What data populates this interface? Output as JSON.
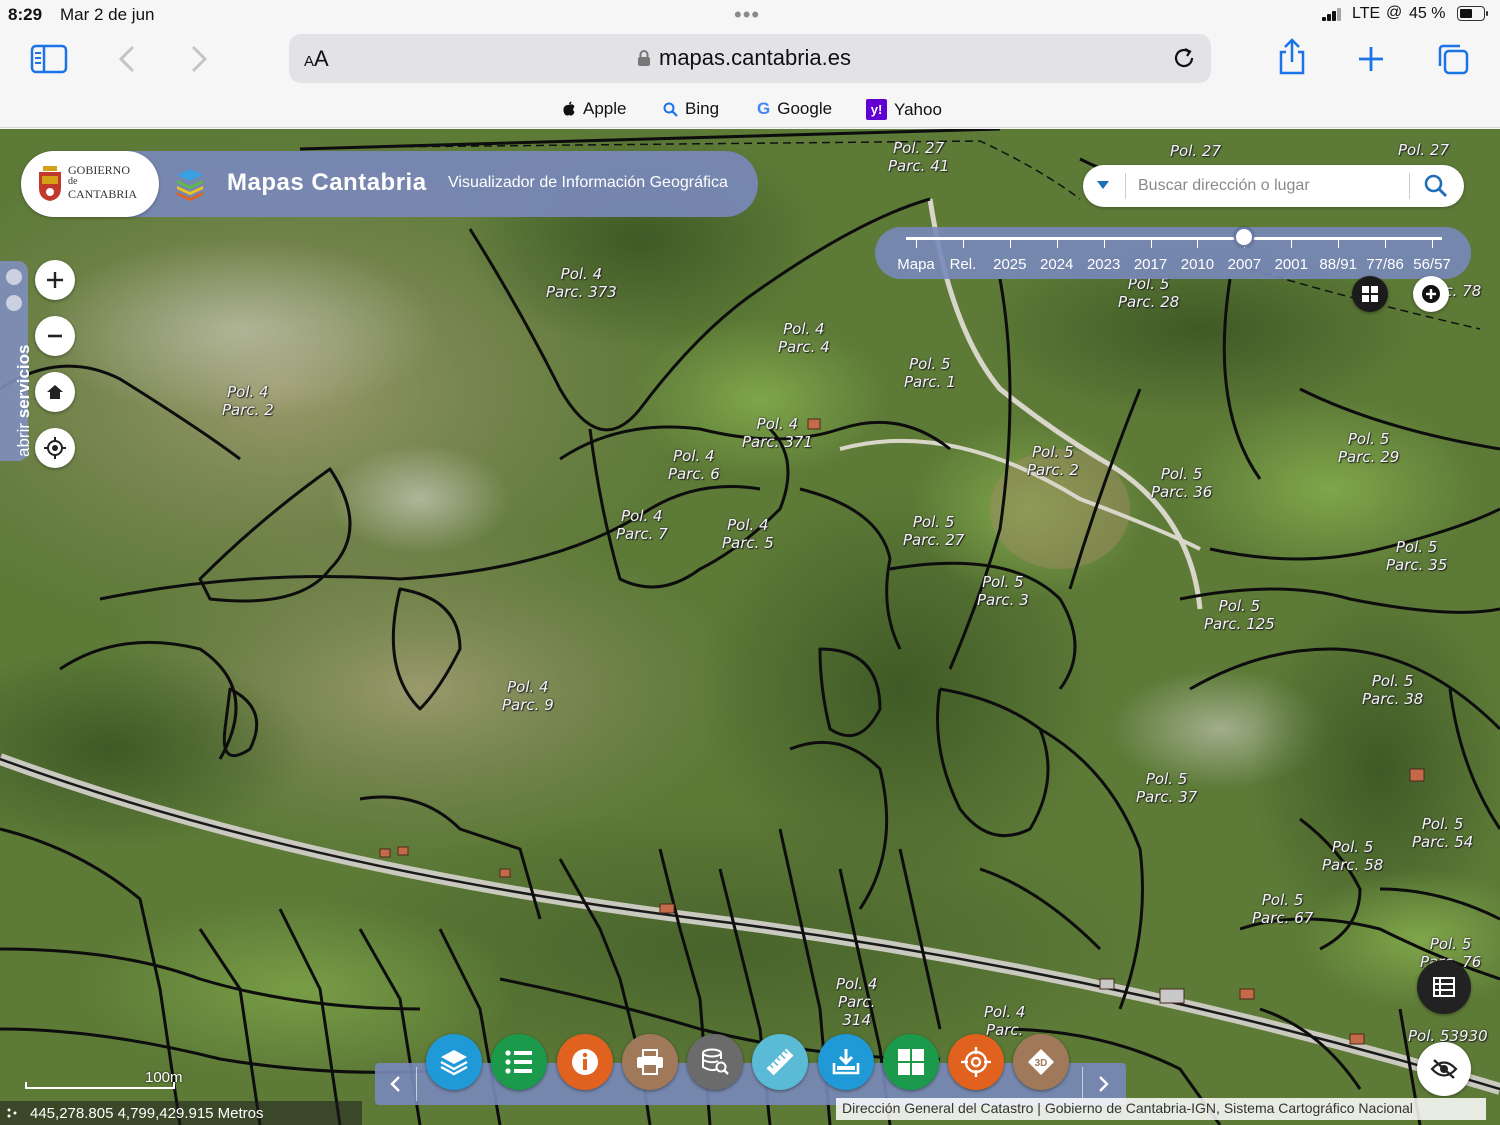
{
  "status": {
    "time": "8:29",
    "date": "Mar 2 de jun",
    "network": "LTE",
    "battery": "45 %",
    "battery_level": 0.45
  },
  "browser": {
    "text_size_button": "AA",
    "url": "mapas.cantabria.es",
    "favorites": [
      {
        "label": "Apple",
        "icon": "apple-icon"
      },
      {
        "label": "Bing",
        "icon": "search-icon"
      },
      {
        "label": "Google",
        "icon": "google-icon"
      },
      {
        "label": "Yahoo",
        "icon": "yahoo-icon"
      }
    ],
    "accent": "#1a73e8"
  },
  "header": {
    "gov_logo_lines": [
      "GOBIERNO",
      "de",
      "CANTABRIA"
    ],
    "title": "Mapas Cantabria",
    "subtitle": "Visualizador de Información Geográfica",
    "accent": "#7888ba"
  },
  "search": {
    "placeholder": "Buscar dirección o lugar"
  },
  "timeline": {
    "labels": [
      "Mapa",
      "Rel.",
      "2025",
      "2024",
      "2023",
      "2017",
      "2010",
      "2007",
      "2001",
      "88/91",
      "77/86",
      "56/57"
    ],
    "selected": "2007",
    "selected_index": 7
  },
  "services": {
    "label_prefix": "abrir",
    "label_bold": "servicios"
  },
  "map": {
    "parcels": [
      {
        "pol": "Pol. 27",
        "parc": "Parc. 41"
      },
      {
        "pol": "Pol. 27",
        "parc": ""
      },
      {
        "pol": "Pol. 27",
        "parc": ""
      },
      {
        "pol": "Pol. 4",
        "parc": "Parc. 373"
      },
      {
        "pol": "Pol. 5",
        "parc": "Parc. 28"
      },
      {
        "pol": "Pol. 4",
        "parc": "Parc. 4"
      },
      {
        "pol": "Pol. 5",
        "parc": "Parc. 1"
      },
      {
        "pol": "Pol. 4",
        "parc": "Parc. 2"
      },
      {
        "pol": "Pol. 4",
        "parc": "Parc. 371"
      },
      {
        "pol": "Pol. 4",
        "parc": "Parc. 6"
      },
      {
        "pol": "Pol. 5",
        "parc": "Parc. 2"
      },
      {
        "pol": "Pol. 5",
        "parc": "Parc. 36"
      },
      {
        "pol": "Pol. 5",
        "parc": "Parc. 29"
      },
      {
        "pol": "Pol. 4",
        "parc": "Parc. 7"
      },
      {
        "pol": "Pol. 4",
        "parc": "Parc. 5"
      },
      {
        "pol": "Pol. 5",
        "parc": "Parc. 27"
      },
      {
        "pol": "Pol. 5",
        "parc": "Parc. 35"
      },
      {
        "pol": "Pol. 5",
        "parc": "Parc. 3"
      },
      {
        "pol": "Pol. 5",
        "parc": "Parc. 125"
      },
      {
        "pol": "Pol. 4",
        "parc": "Parc. 9"
      },
      {
        "pol": "Pol. 5",
        "parc": "Parc. 38"
      },
      {
        "pol": "Pol. 5",
        "parc": "Parc. 37"
      },
      {
        "pol": "Pol. 5",
        "parc": "Parc. 54"
      },
      {
        "pol": "Pol. 5",
        "parc": "Parc. 58"
      },
      {
        "pol": "Pol. 5",
        "parc": "Parc. 67"
      },
      {
        "pol": "Pol. 5",
        "parc": "Parc. 76"
      },
      {
        "pol": "Pol. 4",
        "parc": "Parc.\n314"
      },
      {
        "pol": "Pol. 4",
        "parc": "Parc."
      },
      {
        "pol": "Pol. 53930",
        "parc": ""
      },
      {
        "pol": "",
        "parc": "Parc. 78"
      }
    ],
    "scale_label": "100m",
    "coordinates": "445,278.805 4,799,429.915 Metros",
    "attribution": "Dirección General del Catastro | Gobierno de Cantabria-IGN, Sistema Cartográfico Nacional"
  },
  "tools": [
    {
      "name": "layers-icon",
      "color": "#1f9ad6"
    },
    {
      "name": "legend-list-icon",
      "color": "#1a9a4a"
    },
    {
      "name": "info-icon",
      "color": "#e0621e"
    },
    {
      "name": "print-icon",
      "color": "#a0785a"
    },
    {
      "name": "database-search-icon",
      "color": "#6b6b6b"
    },
    {
      "name": "ruler-icon",
      "color": "#5bbad5"
    },
    {
      "name": "download-icon",
      "color": "#1f9ad6"
    },
    {
      "name": "grid-icon",
      "color": "#1a9a4a"
    },
    {
      "name": "target-icon",
      "color": "#e0621e"
    },
    {
      "name": "3d-icon",
      "color": "#a0785a"
    }
  ]
}
